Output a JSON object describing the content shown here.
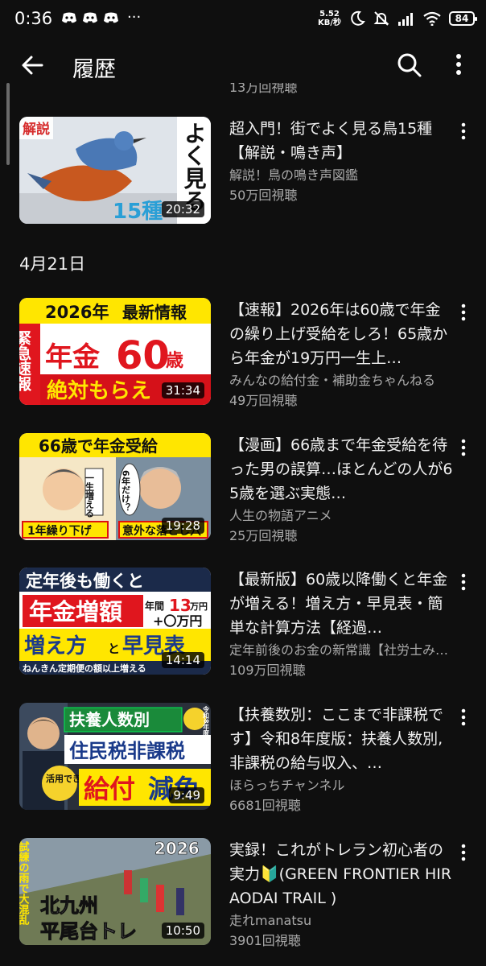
{
  "status_bar": {
    "time": "0:36",
    "speed_value": "5.52",
    "speed_unit": "KB/秒",
    "battery": "84",
    "icons": [
      "discord-icon",
      "discord-icon",
      "discord-icon",
      "more-notifications-icon",
      "moon-icon",
      "bell-off-icon",
      "signal-icon",
      "wifi-icon",
      "battery-icon"
    ],
    "dots": "···"
  },
  "app_bar": {
    "title": "履歴",
    "icons": [
      "back-arrow-icon",
      "search-icon",
      "more-vert-icon"
    ]
  },
  "cut_off_views": "13万回視聴",
  "sections": [
    {
      "date": "",
      "videos": [
        {
          "title": "超入門！街でよく見る鳥15種【解説・鳴き声】",
          "channel": "解説！鳥の鳴き声図鑑",
          "views": "50万回視聴",
          "duration": "20:32",
          "thumb_text": [
            "解説",
            "よく見る",
            "15種"
          ]
        }
      ]
    },
    {
      "date": "4月21日",
      "videos": [
        {
          "title": "【速報】2026年は60歳で年金の繰り上げ受給をしろ！65歳から年金が19万円一生上…",
          "channel": "みんなの給付金・補助金ちゃんねる",
          "views": "49万回視聴",
          "duration": "31:34",
          "thumb_text": [
            "2026年",
            "最新情報",
            "緊急速報",
            "年金",
            "60",
            "歳",
            "絶対もらえ"
          ]
        },
        {
          "title": "【漫画】66歳まで年金受給を待った男の誤算…ほとんどの人が65歳を選ぶ実態…",
          "channel": "人生の物語アニメ",
          "views": "25万回視聴",
          "duration": "19:28",
          "thumb_text": [
            "66歳で年金受給",
            "1年繰り下げ",
            "意外な落とし穴",
            "一生増える",
            "6年だけ？"
          ]
        },
        {
          "title": "【最新版】60歳以降働くと年金が増える！増え方・早見表・簡単な計算方法【経過…",
          "channel": "定年前後のお金の新常識【社労士み…",
          "views": "109万回視聴",
          "duration": "14:14",
          "thumb_text": [
            "定年後も働くと",
            "年金増額",
            "年間",
            "13",
            "万円",
            "+〇万円",
            "増え方",
            "と",
            "早見表",
            "ねんきん定期便の額以上増える"
          ]
        },
        {
          "title": "【扶養数別：ここまで非課税です】令和8年度版：扶養人数別, 非課税の給与収入、…",
          "channel": "ほらっちチャンネル",
          "views": "6681回視聴",
          "duration": "9:49",
          "thumb_text": [
            "扶養人数別",
            "住民税非課税",
            "活用できる",
            "給付",
            "減免",
            "令和8年度"
          ]
        },
        {
          "title": "実録！これがトレラン初心者の実力🔰(GREEN FRONTIER HIRAODAI TRAIL )",
          "channel": "走れmanatsu",
          "views": "3901回視聴",
          "duration": "10:50",
          "thumb_text": [
            "2026",
            "試練の雨で大混乱",
            "北九州",
            "平尾台トレ"
          ]
        }
      ]
    }
  ],
  "colors": {
    "background": "#0f0f0f",
    "primary_text": "#f1f1f1",
    "secondary_text": "#aaaaaa"
  }
}
